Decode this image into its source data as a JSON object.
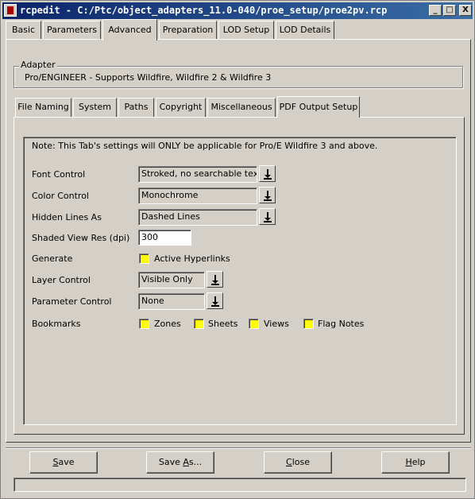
{
  "window": {
    "title": "rcpedit - C:/Ptc/object_adapters_11.0-040/proe_setup/proe2pv.rcp",
    "minimize": "_",
    "maximize": "□",
    "close": "X"
  },
  "top_tabs": [
    "Basic",
    "Parameters",
    "Advanced",
    "Preparation",
    "LOD Setup",
    "LOD Details"
  ],
  "adapter": {
    "legend": "Adapter",
    "description": "Pro/ENGINEER  -  Supports Wildfire, Wildfire 2 & Wildfire 3"
  },
  "sub_tabs": [
    "File Naming",
    "System",
    "Paths",
    "Copyright",
    "Miscellaneous",
    "PDF Output Setup"
  ],
  "pdf": {
    "note": "Note: This Tab's settings will ONLY be applicable for Pro/E Wildfire 3 and above.",
    "font_control": {
      "label": "Font Control",
      "value": "Stroked, no searchable text"
    },
    "color_control": {
      "label": "Color Control",
      "value": "Monochrome"
    },
    "hidden_lines": {
      "label": "Hidden Lines As",
      "value": "Dashed Lines"
    },
    "shaded_res": {
      "label": "Shaded View Res (dpi)",
      "value": "300"
    },
    "generate": {
      "label": "Generate",
      "option": "Active Hyperlinks"
    },
    "layer_control": {
      "label": "Layer Control",
      "value": "Visible Only"
    },
    "parameter_control": {
      "label": "Parameter Control",
      "value": "None"
    },
    "bookmarks": {
      "label": "Bookmarks",
      "options": [
        "Zones",
        "Sheets",
        "Views",
        "Flag Notes"
      ]
    }
  },
  "buttons": {
    "save": {
      "first": "S",
      "rest": "ave"
    },
    "save_as": {
      "pre": "Save ",
      "u": "A",
      "post": "s..."
    },
    "close": {
      "first": "C",
      "rest": "lose"
    },
    "help": {
      "first": "H",
      "rest": "elp"
    }
  },
  "colors": {
    "title_bar": "#0a246a",
    "checkbox_fill": "#ffff00",
    "face": "#d4d0c8"
  }
}
